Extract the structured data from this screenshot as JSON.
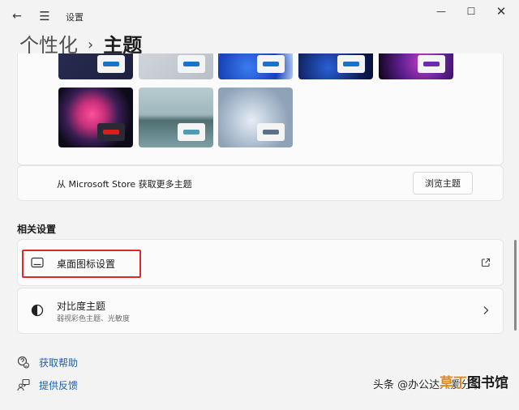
{
  "window": {
    "title": "设置",
    "back_glyph": "←",
    "menu_glyph": "☰",
    "min_glyph": "—",
    "max_glyph": "☐",
    "close_glyph": "✕"
  },
  "breadcrumb": {
    "parent": "个性化",
    "separator": "›",
    "current": "主题"
  },
  "store": {
    "text": "从 Microsoft Store 获取更多主题",
    "button": "浏览主题"
  },
  "related": {
    "title": "相关设置",
    "desktop_icons": {
      "label": "桌面图标设置"
    },
    "contrast": {
      "label": "对比度主题",
      "sub": "弱视彩色主题、光敏度"
    }
  },
  "links": {
    "help": "获取帮助",
    "feedback": "提供反馈"
  },
  "watermark": {
    "text": "头条 @办公达人爱分享",
    "brand_part1": "草丁",
    "brand_part2": "图书馆"
  },
  "colors": {
    "accent": "#0067c0",
    "highlight": "#e0262c",
    "link": "#1a5fb4"
  }
}
